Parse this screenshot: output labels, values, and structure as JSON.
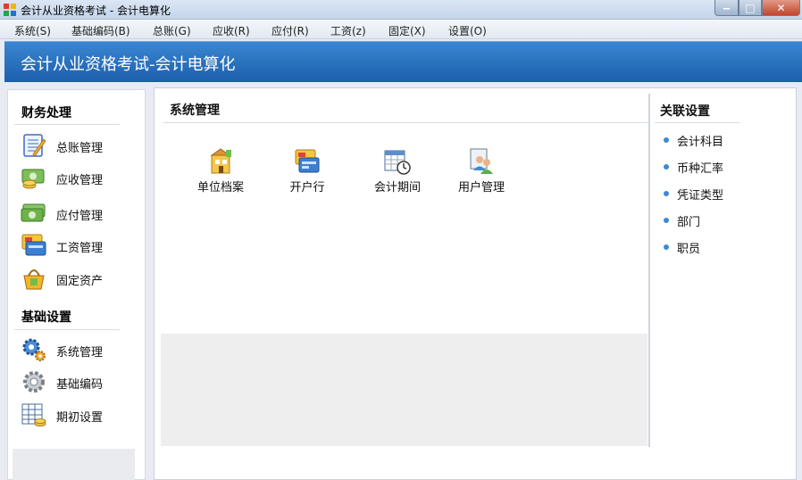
{
  "window": {
    "title": "会计从业资格考试 - 会计电算化",
    "minimize_glyph": "‒",
    "maximize_glyph": "□",
    "close_glyph": "✕"
  },
  "menu": [
    "系统(S)",
    "基础编码(B)",
    "总账(G)",
    "应收(R)",
    "应付(R)",
    "工资(z)",
    "固定(X)",
    "设置(O)"
  ],
  "banner": {
    "title": "会计从业资格考试-会计电算化"
  },
  "sidebar": {
    "finance_title": "财务处理",
    "finance_items": [
      {
        "label": "总账管理",
        "icon": "ledger-icon"
      },
      {
        "label": "应收管理",
        "icon": "receivable-icon"
      },
      {
        "label": "应付管理",
        "icon": "payable-icon"
      },
      {
        "label": "工资管理",
        "icon": "salary-icon"
      },
      {
        "label": "固定资产",
        "icon": "fixed-asset-icon"
      }
    ],
    "basic_title": "基础设置",
    "basic_items": [
      {
        "label": "系统管理",
        "icon": "system-gear-icon"
      },
      {
        "label": "基础编码",
        "icon": "basic-code-gear-icon"
      },
      {
        "label": "期初设置",
        "icon": "opening-setup-icon"
      }
    ]
  },
  "main": {
    "title": "系统管理",
    "tiles": [
      {
        "label": "单位档案",
        "icon": "company-file-icon"
      },
      {
        "label": "开户行",
        "icon": "bank-card-icon"
      },
      {
        "label": "会计期间",
        "icon": "calendar-clock-icon"
      },
      {
        "label": "用户管理",
        "icon": "users-icon"
      }
    ]
  },
  "related": {
    "title": "关联设置",
    "links": [
      "会计科目",
      "币种汇率",
      "凭证类型",
      "部门",
      "职员"
    ]
  },
  "colors": {
    "banner": "#1c5fab",
    "link_dot": "#3c8ad6",
    "close_button": "#c4432b"
  }
}
